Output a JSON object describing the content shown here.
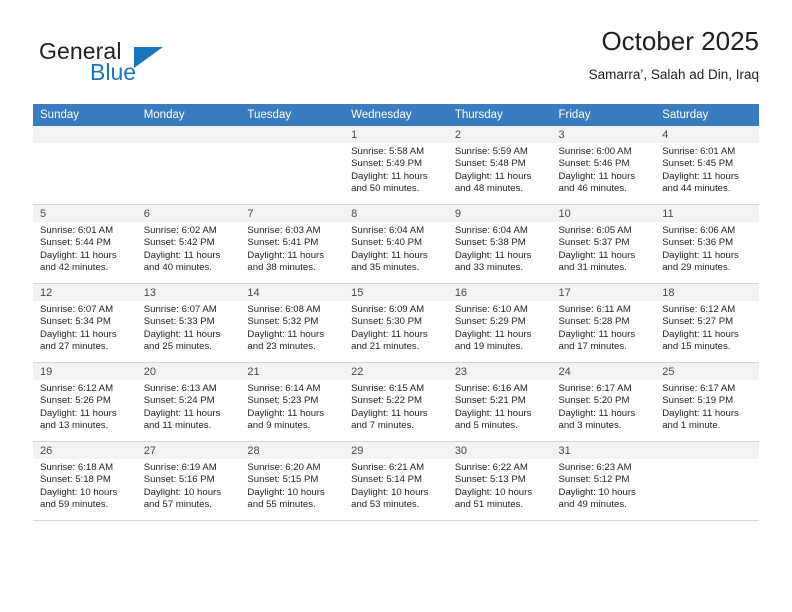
{
  "brand": {
    "name_part1": "General",
    "name_part2": "Blue",
    "accent_color": "#1b75bb"
  },
  "header": {
    "title": "October 2025",
    "location": "Samarra’, Salah ad Din, Iraq"
  },
  "calendar": {
    "header_color": "#3a7cc0",
    "weekday_headers": [
      "Sunday",
      "Monday",
      "Tuesday",
      "Wednesday",
      "Thursday",
      "Friday",
      "Saturday"
    ],
    "weeks": [
      [
        {
          "day": "",
          "sunrise": "",
          "sunset": "",
          "daylight_line1": "",
          "daylight_line2": ""
        },
        {
          "day": "",
          "sunrise": "",
          "sunset": "",
          "daylight_line1": "",
          "daylight_line2": ""
        },
        {
          "day": "",
          "sunrise": "",
          "sunset": "",
          "daylight_line1": "",
          "daylight_line2": ""
        },
        {
          "day": "1",
          "sunrise": "Sunrise: 5:58 AM",
          "sunset": "Sunset: 5:49 PM",
          "daylight_line1": "Daylight: 11 hours",
          "daylight_line2": "and 50 minutes."
        },
        {
          "day": "2",
          "sunrise": "Sunrise: 5:59 AM",
          "sunset": "Sunset: 5:48 PM",
          "daylight_line1": "Daylight: 11 hours",
          "daylight_line2": "and 48 minutes."
        },
        {
          "day": "3",
          "sunrise": "Sunrise: 6:00 AM",
          "sunset": "Sunset: 5:46 PM",
          "daylight_line1": "Daylight: 11 hours",
          "daylight_line2": "and 46 minutes."
        },
        {
          "day": "4",
          "sunrise": "Sunrise: 6:01 AM",
          "sunset": "Sunset: 5:45 PM",
          "daylight_line1": "Daylight: 11 hours",
          "daylight_line2": "and 44 minutes."
        }
      ],
      [
        {
          "day": "5",
          "sunrise": "Sunrise: 6:01 AM",
          "sunset": "Sunset: 5:44 PM",
          "daylight_line1": "Daylight: 11 hours",
          "daylight_line2": "and 42 minutes."
        },
        {
          "day": "6",
          "sunrise": "Sunrise: 6:02 AM",
          "sunset": "Sunset: 5:42 PM",
          "daylight_line1": "Daylight: 11 hours",
          "daylight_line2": "and 40 minutes."
        },
        {
          "day": "7",
          "sunrise": "Sunrise: 6:03 AM",
          "sunset": "Sunset: 5:41 PM",
          "daylight_line1": "Daylight: 11 hours",
          "daylight_line2": "and 38 minutes."
        },
        {
          "day": "8",
          "sunrise": "Sunrise: 6:04 AM",
          "sunset": "Sunset: 5:40 PM",
          "daylight_line1": "Daylight: 11 hours",
          "daylight_line2": "and 35 minutes."
        },
        {
          "day": "9",
          "sunrise": "Sunrise: 6:04 AM",
          "sunset": "Sunset: 5:38 PM",
          "daylight_line1": "Daylight: 11 hours",
          "daylight_line2": "and 33 minutes."
        },
        {
          "day": "10",
          "sunrise": "Sunrise: 6:05 AM",
          "sunset": "Sunset: 5:37 PM",
          "daylight_line1": "Daylight: 11 hours",
          "daylight_line2": "and 31 minutes."
        },
        {
          "day": "11",
          "sunrise": "Sunrise: 6:06 AM",
          "sunset": "Sunset: 5:36 PM",
          "daylight_line1": "Daylight: 11 hours",
          "daylight_line2": "and 29 minutes."
        }
      ],
      [
        {
          "day": "12",
          "sunrise": "Sunrise: 6:07 AM",
          "sunset": "Sunset: 5:34 PM",
          "daylight_line1": "Daylight: 11 hours",
          "daylight_line2": "and 27 minutes."
        },
        {
          "day": "13",
          "sunrise": "Sunrise: 6:07 AM",
          "sunset": "Sunset: 5:33 PM",
          "daylight_line1": "Daylight: 11 hours",
          "daylight_line2": "and 25 minutes."
        },
        {
          "day": "14",
          "sunrise": "Sunrise: 6:08 AM",
          "sunset": "Sunset: 5:32 PM",
          "daylight_line1": "Daylight: 11 hours",
          "daylight_line2": "and 23 minutes."
        },
        {
          "day": "15",
          "sunrise": "Sunrise: 6:09 AM",
          "sunset": "Sunset: 5:30 PM",
          "daylight_line1": "Daylight: 11 hours",
          "daylight_line2": "and 21 minutes."
        },
        {
          "day": "16",
          "sunrise": "Sunrise: 6:10 AM",
          "sunset": "Sunset: 5:29 PM",
          "daylight_line1": "Daylight: 11 hours",
          "daylight_line2": "and 19 minutes."
        },
        {
          "day": "17",
          "sunrise": "Sunrise: 6:11 AM",
          "sunset": "Sunset: 5:28 PM",
          "daylight_line1": "Daylight: 11 hours",
          "daylight_line2": "and 17 minutes."
        },
        {
          "day": "18",
          "sunrise": "Sunrise: 6:12 AM",
          "sunset": "Sunset: 5:27 PM",
          "daylight_line1": "Daylight: 11 hours",
          "daylight_line2": "and 15 minutes."
        }
      ],
      [
        {
          "day": "19",
          "sunrise": "Sunrise: 6:12 AM",
          "sunset": "Sunset: 5:26 PM",
          "daylight_line1": "Daylight: 11 hours",
          "daylight_line2": "and 13 minutes."
        },
        {
          "day": "20",
          "sunrise": "Sunrise: 6:13 AM",
          "sunset": "Sunset: 5:24 PM",
          "daylight_line1": "Daylight: 11 hours",
          "daylight_line2": "and 11 minutes."
        },
        {
          "day": "21",
          "sunrise": "Sunrise: 6:14 AM",
          "sunset": "Sunset: 5:23 PM",
          "daylight_line1": "Daylight: 11 hours",
          "daylight_line2": "and 9 minutes."
        },
        {
          "day": "22",
          "sunrise": "Sunrise: 6:15 AM",
          "sunset": "Sunset: 5:22 PM",
          "daylight_line1": "Daylight: 11 hours",
          "daylight_line2": "and 7 minutes."
        },
        {
          "day": "23",
          "sunrise": "Sunrise: 6:16 AM",
          "sunset": "Sunset: 5:21 PM",
          "daylight_line1": "Daylight: 11 hours",
          "daylight_line2": "and 5 minutes."
        },
        {
          "day": "24",
          "sunrise": "Sunrise: 6:17 AM",
          "sunset": "Sunset: 5:20 PM",
          "daylight_line1": "Daylight: 11 hours",
          "daylight_line2": "and 3 minutes."
        },
        {
          "day": "25",
          "sunrise": "Sunrise: 6:17 AM",
          "sunset": "Sunset: 5:19 PM",
          "daylight_line1": "Daylight: 11 hours",
          "daylight_line2": "and 1 minute."
        }
      ],
      [
        {
          "day": "26",
          "sunrise": "Sunrise: 6:18 AM",
          "sunset": "Sunset: 5:18 PM",
          "daylight_line1": "Daylight: 10 hours",
          "daylight_line2": "and 59 minutes."
        },
        {
          "day": "27",
          "sunrise": "Sunrise: 6:19 AM",
          "sunset": "Sunset: 5:16 PM",
          "daylight_line1": "Daylight: 10 hours",
          "daylight_line2": "and 57 minutes."
        },
        {
          "day": "28",
          "sunrise": "Sunrise: 6:20 AM",
          "sunset": "Sunset: 5:15 PM",
          "daylight_line1": "Daylight: 10 hours",
          "daylight_line2": "and 55 minutes."
        },
        {
          "day": "29",
          "sunrise": "Sunrise: 6:21 AM",
          "sunset": "Sunset: 5:14 PM",
          "daylight_line1": "Daylight: 10 hours",
          "daylight_line2": "and 53 minutes."
        },
        {
          "day": "30",
          "sunrise": "Sunrise: 6:22 AM",
          "sunset": "Sunset: 5:13 PM",
          "daylight_line1": "Daylight: 10 hours",
          "daylight_line2": "and 51 minutes."
        },
        {
          "day": "31",
          "sunrise": "Sunrise: 6:23 AM",
          "sunset": "Sunset: 5:12 PM",
          "daylight_line1": "Daylight: 10 hours",
          "daylight_line2": "and 49 minutes."
        },
        {
          "day": "",
          "sunrise": "",
          "sunset": "",
          "daylight_line1": "",
          "daylight_line2": ""
        }
      ]
    ]
  }
}
